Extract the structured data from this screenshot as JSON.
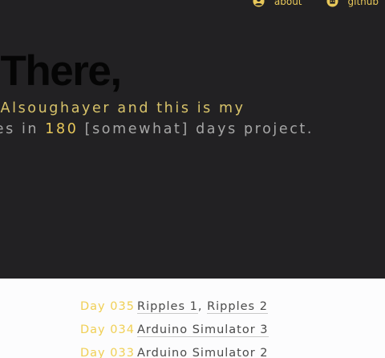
{
  "nav": {
    "about": "about",
    "github": "github"
  },
  "hero": {
    "greeting": "llo There,",
    "line1": "houg Alsoughayer and this is my",
    "line2_a": "ebsites in ",
    "line2_num": "180",
    "line2_b": " [somewhat] days project."
  },
  "days": [
    {
      "day": "Day 035",
      "projects": [
        "Ripples 1",
        "Ripples 2"
      ]
    },
    {
      "day": "Day 034",
      "projects": [
        "Arduino Simulator 3"
      ]
    },
    {
      "day": "Day 033",
      "projects": [
        "Arduino Simulator 2"
      ]
    }
  ],
  "colors": {
    "hero_bg": "#222123",
    "accent": "#e8c85a",
    "page_bg": "#fcfcfd"
  }
}
